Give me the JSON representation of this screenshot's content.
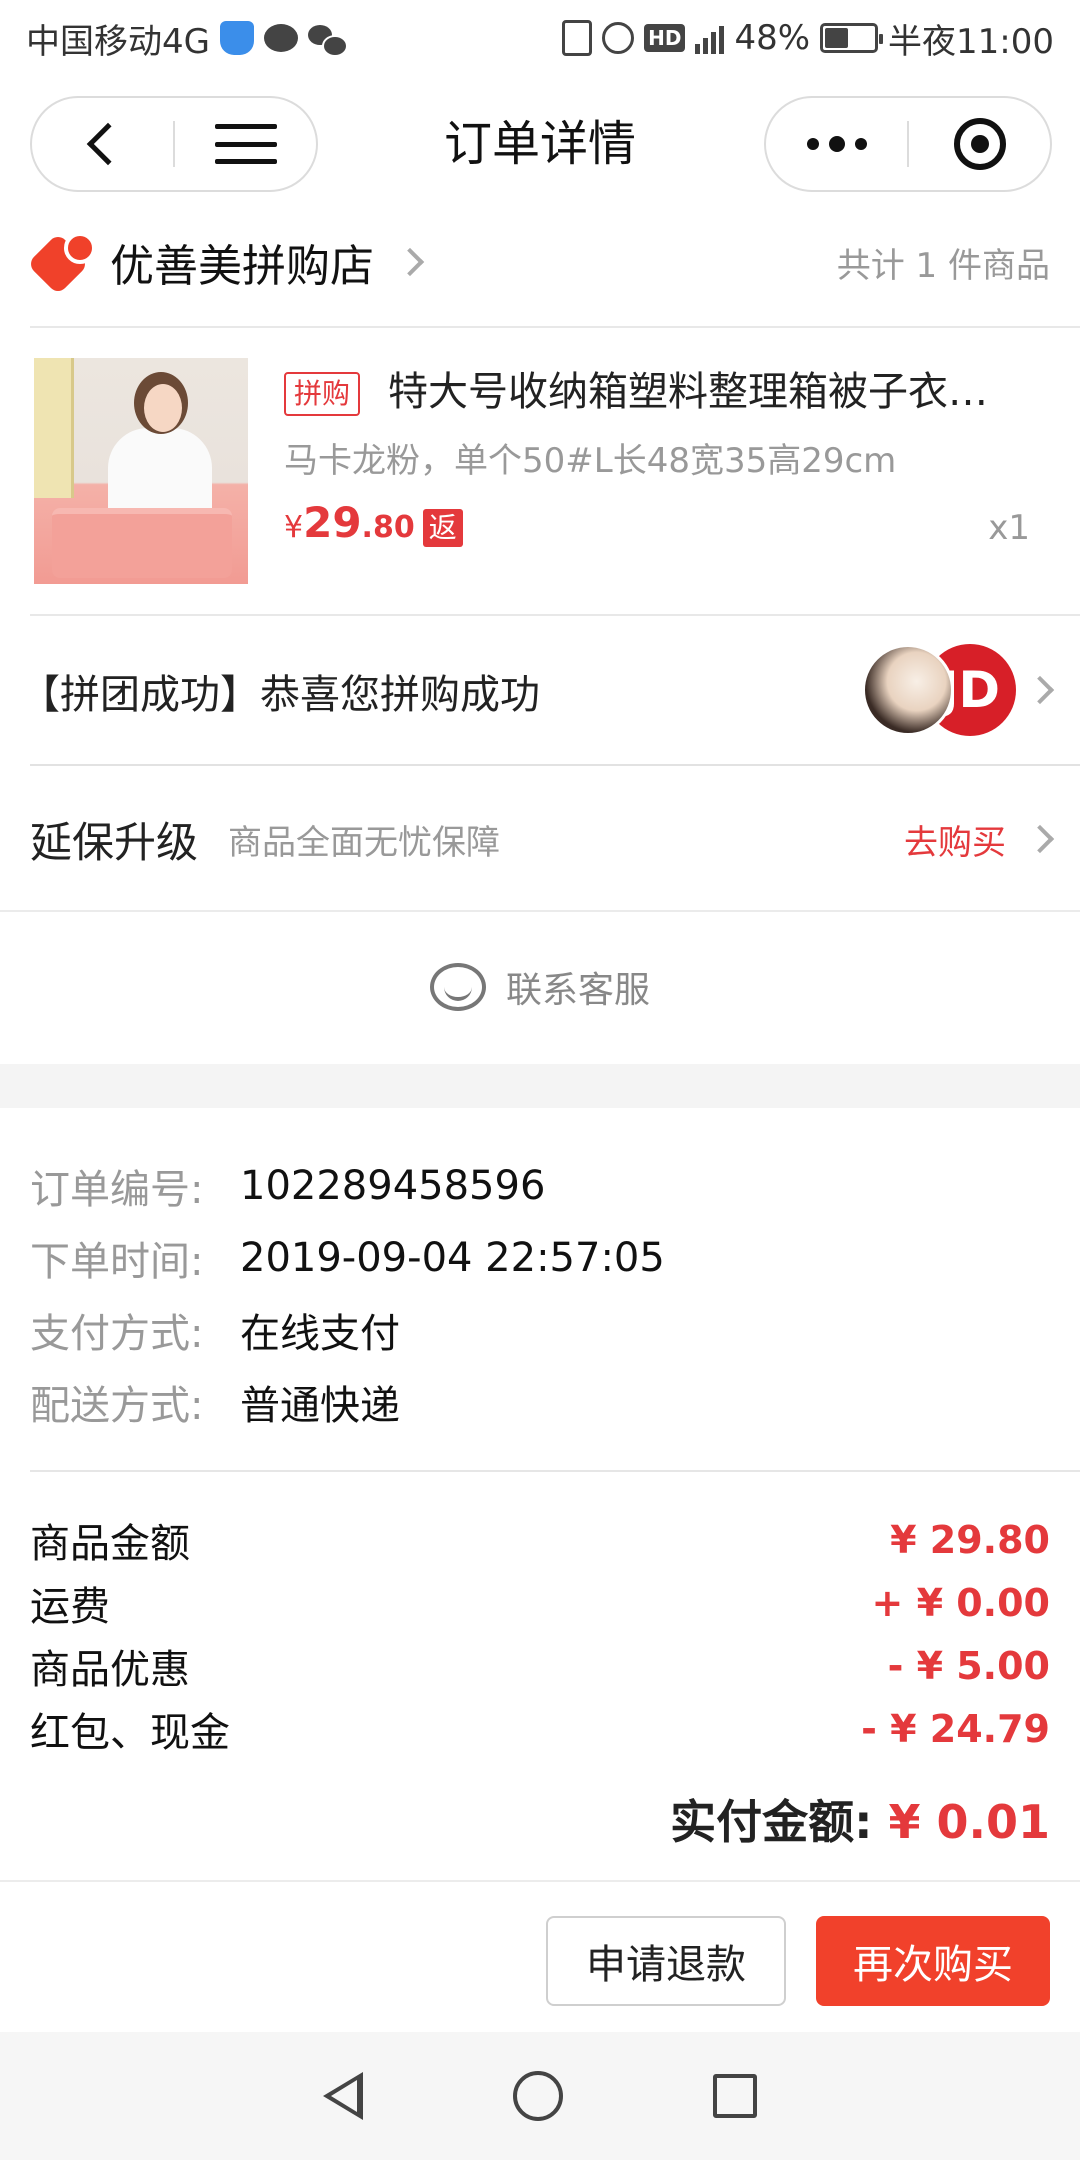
{
  "status_bar": {
    "carrier": "中国移动4G",
    "network": "4G",
    "battery": "48%",
    "battery_level": 0.48,
    "time": "半夜11:00",
    "icons": [
      "shield-icon",
      "message-bubble-icon",
      "wechat-icon",
      "vibrate-icon",
      "alarm-icon",
      "hd-icon",
      "signal-icon",
      "battery-icon"
    ]
  },
  "navbar": {
    "title": "订单详情",
    "hd_label": "HD"
  },
  "store": {
    "name": "优善美拼购店",
    "item_count": "共计 1 件商品"
  },
  "product": {
    "tag": "拼购",
    "title": "特大号收纳箱塑料整理箱被子衣…",
    "spec": "马卡龙粉，单个50#L长48宽35高29cm",
    "price_symbol": "¥",
    "price_int": "29",
    "price_dec": ".80",
    "rebate_badge": "返",
    "quantity": "x1"
  },
  "group": {
    "text": "【拼团成功】恭喜您拼购成功",
    "avatar_label": "JD"
  },
  "warranty": {
    "title": "延保升级",
    "subtitle": "商品全面无忧保障",
    "link": "去购买"
  },
  "service": {
    "label": "联系客服"
  },
  "order_info": [
    {
      "label": "订单编号:",
      "value": "102289458596"
    },
    {
      "label": "下单时间:",
      "value": "2019-09-04 22:57:05"
    },
    {
      "label": "支付方式:",
      "value": "在线支付"
    },
    {
      "label": "配送方式:",
      "value": "普通快递"
    }
  ],
  "amounts": [
    {
      "label": "商品金额",
      "value": "¥ 29.80"
    },
    {
      "label": "运费",
      "value": "+ ¥ 0.00"
    },
    {
      "label": "商品优惠",
      "value": "- ¥ 5.00"
    },
    {
      "label": "红包、现金",
      "value": "- ¥ 24.79"
    }
  ],
  "total": {
    "label": "实付金额:",
    "value": "¥ 0.01"
  },
  "buttons": {
    "refund": "申请退款",
    "rebuy": "再次购买"
  },
  "colors": {
    "accent": "#e4393c",
    "primary_button": "#f1412b"
  }
}
